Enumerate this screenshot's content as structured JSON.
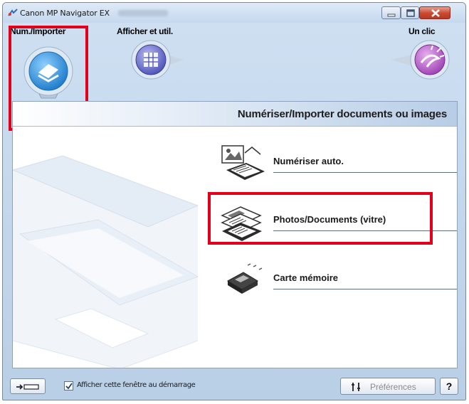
{
  "window": {
    "title": "Canon MP Navigator EX"
  },
  "modes": [
    {
      "label": "Num./Importer",
      "selected": true,
      "icon": "scan-import-icon"
    },
    {
      "label": "Afficher et util.",
      "selected": false,
      "icon": "view-use-icon"
    },
    {
      "label": "Un clic",
      "selected": false,
      "icon": "one-click-icon"
    }
  ],
  "content": {
    "title": "Numériser/Importer documents ou images",
    "actions": [
      {
        "label": "Numériser auto.",
        "icon": "auto-scan-icon",
        "highlighted": false
      },
      {
        "label": "Photos/Documents (vitre)",
        "icon": "photos-documents-platen-icon",
        "highlighted": true
      },
      {
        "label": "Carte mémoire",
        "icon": "memory-card-icon",
        "highlighted": false
      }
    ]
  },
  "footer": {
    "show_on_startup_label": "Afficher cette fenêtre au démarrage",
    "show_on_startup_checked": true,
    "preferences_label": "Préférences",
    "help_label": "?"
  },
  "colors": {
    "highlight_border": "#e3001b",
    "accent_blue": "#2f8fd8",
    "accent_purple": "#9b3fb3"
  }
}
